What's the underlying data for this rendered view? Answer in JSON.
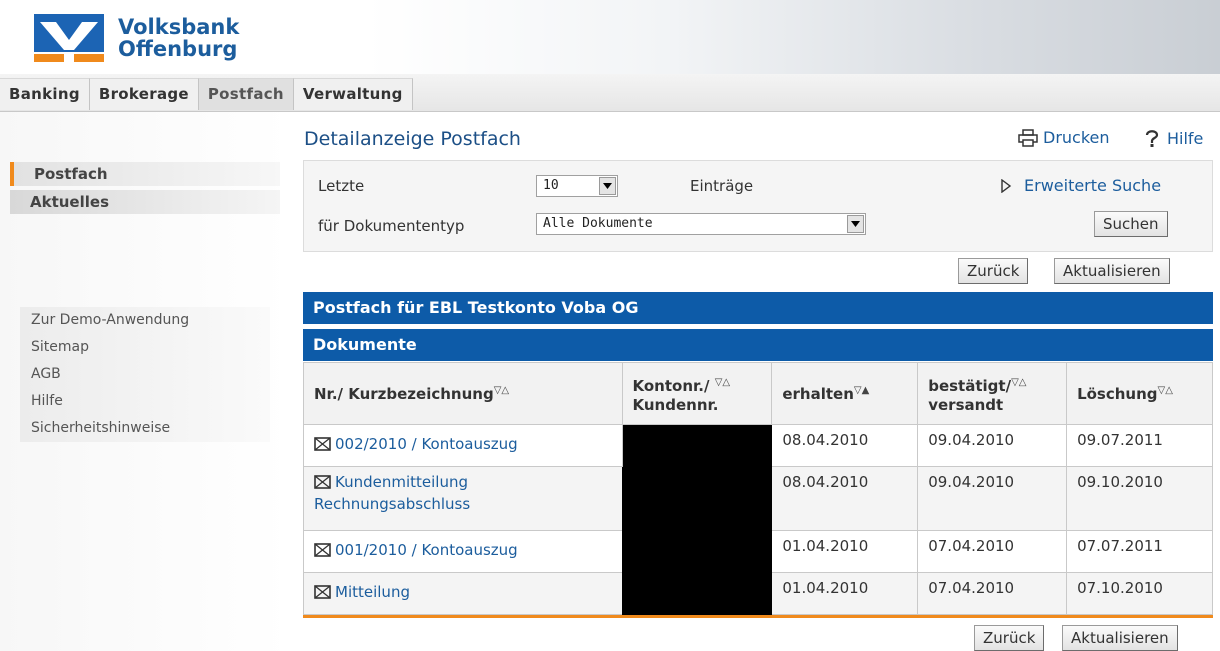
{
  "brand": {
    "line1": "Volksbank",
    "line2": "Offenburg"
  },
  "tabs": [
    {
      "label": "Banking"
    },
    {
      "label": "Brokerage"
    },
    {
      "label": "Postfach"
    },
    {
      "label": "Verwaltung"
    }
  ],
  "sidebar": {
    "main": [
      {
        "label": "Postfach"
      },
      {
        "label": "Aktuelles"
      }
    ],
    "links": [
      {
        "label": "Zur Demo-Anwendung"
      },
      {
        "label": "Sitemap"
      },
      {
        "label": "AGB"
      },
      {
        "label": "Hilfe"
      },
      {
        "label": "Sicherheitshinweise"
      }
    ]
  },
  "page": {
    "title": "Detailanzeige Postfach",
    "print_label": "Drucken",
    "help_label": "Hilfe"
  },
  "filter": {
    "letzte_label": "Letzte",
    "count_value": "10",
    "entries_label": "Einträge",
    "doctype_label": "für Dokumententyp",
    "doctype_value": "Alle Dokumente",
    "extended_search": "Erweiterte Suche",
    "search_button": "Suchen"
  },
  "actions": {
    "back": "Zurück",
    "refresh": "Aktualisieren"
  },
  "mailbox_title": "Postfach für EBL Testkonto Voba OG",
  "documents_title": "Dokumente",
  "table": {
    "headers": {
      "nr": "Nr./ Kurzbezeichnung",
      "konto1": "Kontonr./",
      "konto2": "Kundennr.",
      "erhalten": "erhalten",
      "bestaetigt1": "bestätigt/",
      "bestaetigt2": "versandt",
      "loeschung": "Löschung"
    },
    "sort_desc": "▽",
    "sort_asc": "△",
    "sort_asc_filled": "▲",
    "rows": [
      {
        "line1": "002/2010 / Kontoauszug",
        "line2": "",
        "erhalten": "08.04.2010",
        "bestaetigt": "09.04.2010",
        "loeschung": "09.07.2011"
      },
      {
        "line1": "Kundenmitteilung",
        "line2": "Rechnungsabschluss",
        "erhalten": "08.04.2010",
        "bestaetigt": "09.04.2010",
        "loeschung": "09.10.2010"
      },
      {
        "line1": "001/2010 / Kontoauszug",
        "line2": "",
        "erhalten": "01.04.2010",
        "bestaetigt": "07.04.2010",
        "loeschung": "07.07.2011"
      },
      {
        "line1": "Mitteilung",
        "line2": "",
        "erhalten": "01.04.2010",
        "bestaetigt": "07.04.2010",
        "loeschung": "07.10.2010"
      }
    ]
  },
  "colors": {
    "brand_blue": "#0d5ba8",
    "accent_orange": "#f08a1c",
    "link": "#1c5d9d"
  }
}
